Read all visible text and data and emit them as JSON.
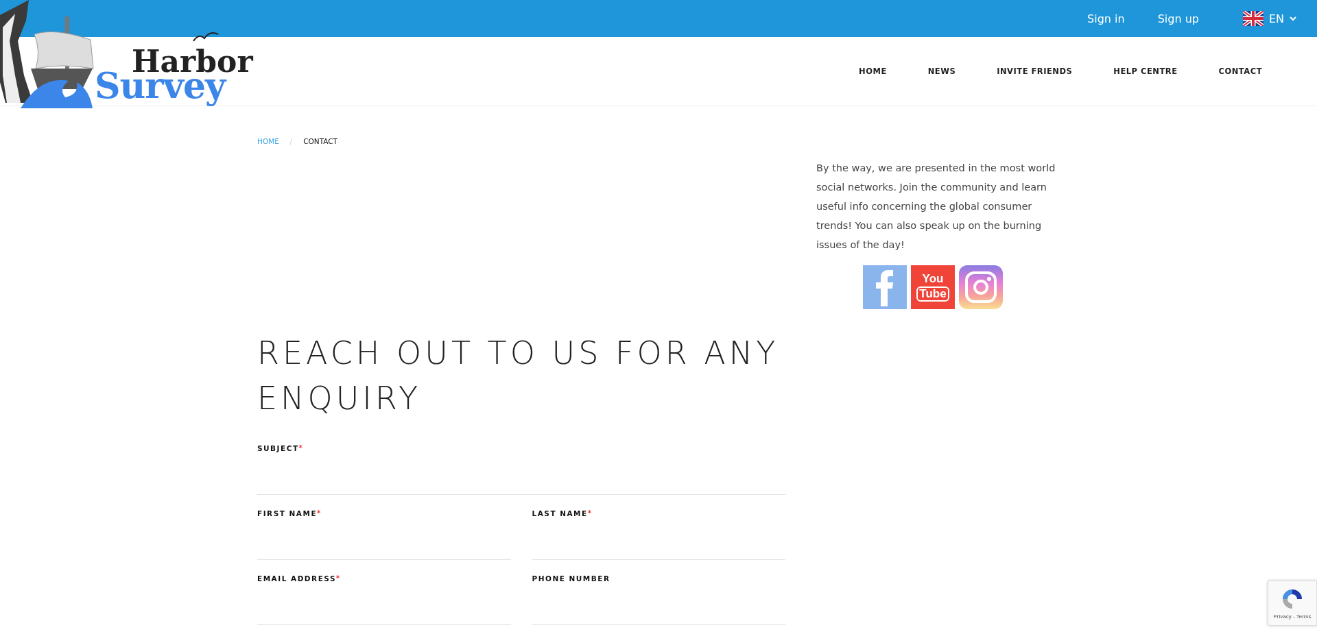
{
  "top_bar": {
    "links": [
      "Sign in",
      "Sign up"
    ],
    "language": "EN"
  },
  "logo": {
    "word_1": "Harbor",
    "word_2": "Survey"
  },
  "nav": {
    "items": [
      "HOME",
      "NEWS",
      "INVITE FRIENDS",
      "HELP CENTRE",
      "CONTACT"
    ]
  },
  "breadcrumb": {
    "separator": "/",
    "items": [
      {
        "label": "HOME",
        "kind": "link"
      },
      {
        "label": "CONTACT",
        "kind": "current"
      }
    ]
  },
  "heading": "REACH OUT TO US FOR ANY ENQUIRY",
  "form": {
    "rows": [
      [
        {
          "label": "SUBJECT",
          "required_mark": "*"
        }
      ],
      [
        {
          "label": "FIRST NAME",
          "required_mark": "*"
        },
        {
          "label": "LAST NAME",
          "required_mark": "*"
        }
      ],
      [
        {
          "label": "EMAIL ADDRESS",
          "required_mark": "*"
        },
        {
          "label": "PHONE NUMBER"
        }
      ]
    ]
  },
  "aside": {
    "text": "By the way, we are presented in the most world social networks. Join the community and learn useful info concerning the global consumer trends! You can also speak up on the burning issues of the day!",
    "social": [
      {
        "kind": "facebook"
      },
      {
        "kind": "youtube",
        "word_1": "You",
        "word_2": "Tube"
      },
      {
        "kind": "instagram"
      }
    ]
  },
  "recaptcha": {
    "text": "Privacy - Terms"
  }
}
